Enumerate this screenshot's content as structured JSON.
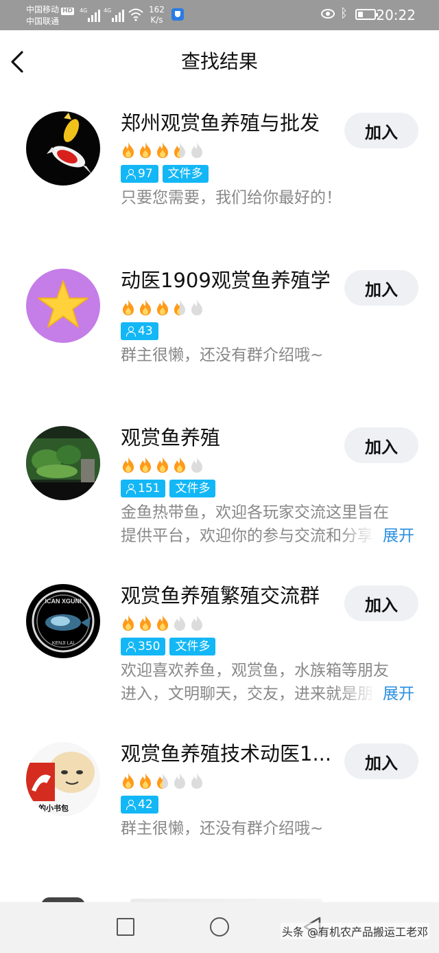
{
  "status_bar": {
    "carrier_1": "中国移动",
    "hd_badge": "HD",
    "carrier_2": "中国联通",
    "net_1": "4G",
    "net_2": "4G",
    "speed_value": "162",
    "speed_unit": "K/s",
    "time": "20:22"
  },
  "header": {
    "title": "查找结果"
  },
  "groups": [
    {
      "name": "郑州观赏鱼养殖与批发",
      "flames": [
        1,
        1,
        1,
        0.5,
        0
      ],
      "members": "97",
      "tag": "文件多",
      "desc_line1": "只要您需要，我们给你最好的！",
      "join_label": "加入"
    },
    {
      "name": "动医1909观赏鱼养殖学",
      "flames": [
        1,
        1,
        1,
        0.5,
        0
      ],
      "members": "43",
      "desc_line1": "群主很懒，还没有群介绍哦~",
      "join_label": "加入"
    },
    {
      "name": "观赏鱼养殖",
      "flames": [
        1,
        1,
        1,
        1,
        0
      ],
      "members": "151",
      "tag": "文件多",
      "desc_line1": "金鱼热带鱼，欢迎各玩家交流这里旨在",
      "desc_line2": "提供平台，欢迎你的参与交流和分享",
      "expand_label": "展开",
      "join_label": "加入"
    },
    {
      "name": "观赏鱼养殖繁殖交流群",
      "flames": [
        1,
        1,
        1,
        0,
        0
      ],
      "members": "350",
      "tag": "文件多",
      "desc_line1": "欢迎喜欢养鱼，观赏鱼，水族箱等朋友",
      "desc_line2": "进入，文明聊天，交友，进来就是朋友",
      "expand_label": "展开",
      "join_label": "加入",
      "avatar_text_1": "ICAN XGUNI",
      "avatar_text_2": "KENJI LAI"
    },
    {
      "name": "观赏鱼养殖技术动医1...",
      "flames": [
        1,
        1,
        0.5,
        0,
        0
      ],
      "members": "42",
      "desc_line1": "群主很懒，还没有群介绍哦~",
      "join_label": "加入",
      "avatar_text": "的小书包"
    }
  ],
  "watermark": "头条 @有机农产品搬运工老邓",
  "colors": {
    "tag_blue": "#13b7f5",
    "flame_orange": "#ff9a1a",
    "flame_empty": "#dcdcdc",
    "expand_blue": "#2a8fe0",
    "join_bg": "#eef0f4"
  }
}
